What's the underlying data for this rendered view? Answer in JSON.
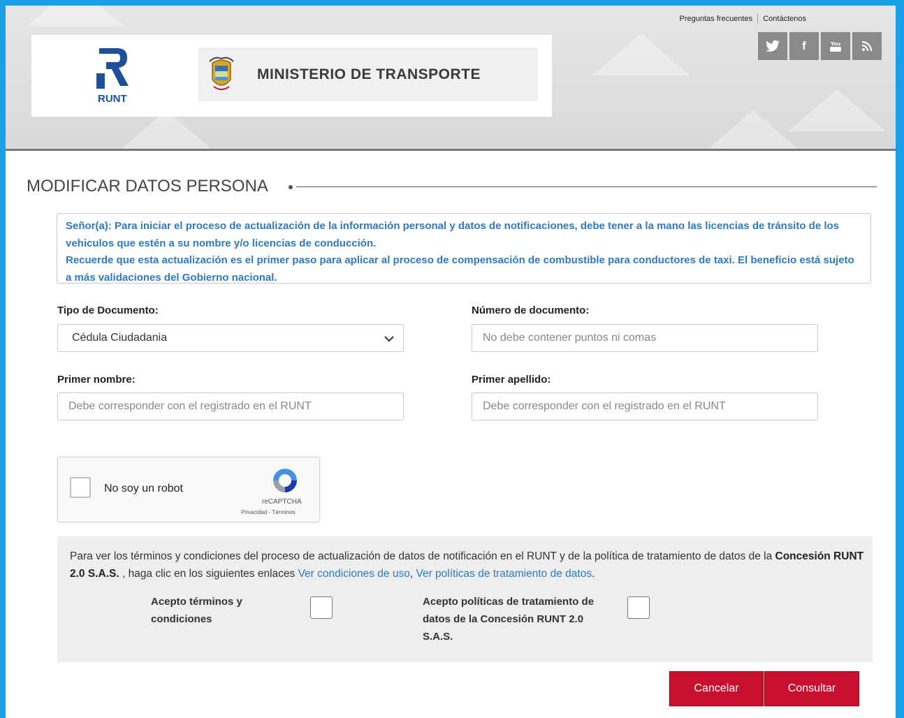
{
  "header": {
    "links": {
      "faq": "Preguntas frecuentes",
      "contact": "Contáctenos"
    },
    "social": [
      "twitter-icon",
      "facebook-icon",
      "youtube-icon",
      "rss-icon"
    ],
    "runt_logo_text": "RUNT",
    "ministry_name": "MINISTERIO DE TRANSPORTE"
  },
  "page": {
    "title": "MODIFICAR DATOS PERSONA"
  },
  "notice": {
    "line1": "Señor(a): Para iniciar el proceso de actualización de la información personal y datos de notificaciones, debe tener a la mano las licencias de tránsito de los vehiculos que estén a su nombre y/o licencias de conducción.",
    "line2": "Recuerde que esta actualización es el primer paso para aplicar al proceso de compensación de combustible para conductores de taxi. El beneficio está sujeto a más validaciones del Gobierno nacional."
  },
  "form": {
    "doc_type_label": "Tipo de Documento:",
    "doc_type_value": "Cédula Ciudadania",
    "doc_number_label": "Número de documento:",
    "doc_number_placeholder": "No debe contener puntos ni comas",
    "first_name_label": "Primer nombre:",
    "first_name_placeholder": "Debe corresponder con el registrado en el RUNT",
    "last_name_label": "Primer apellido:",
    "last_name_placeholder": "Debe corresponder con el registrado en el RUNT"
  },
  "captcha": {
    "label": "No soy un robot",
    "brand": "reCAPTCHA",
    "links": "Privacidad - Términos"
  },
  "terms": {
    "text_before": "Para ver los términos y condiciones del proceso de actualización de datos de notificación en el RUNT y de la política de tratamiento de datos de la ",
    "company": "Concesión RUNT 2.0 S.A.S.",
    "text_after": " , haga clic en los siguientes enlaces ",
    "link1": "Ver condiciones de uso",
    "comma": ", ",
    "link2": "Ver políticas de tratamiento de datos",
    "period": ".",
    "accept_terms": "Acepto términos y condiciones",
    "accept_policies": "Acepto políticas de tratamiento de datos de la Concesión RUNT 2.0 S.A.S."
  },
  "buttons": {
    "cancel": "Cancelar",
    "submit": "Consultar"
  },
  "colors": {
    "accent_blue": "#2d7ac2",
    "button_red": "#c8102e",
    "frame_blue": "#19a0e6"
  }
}
